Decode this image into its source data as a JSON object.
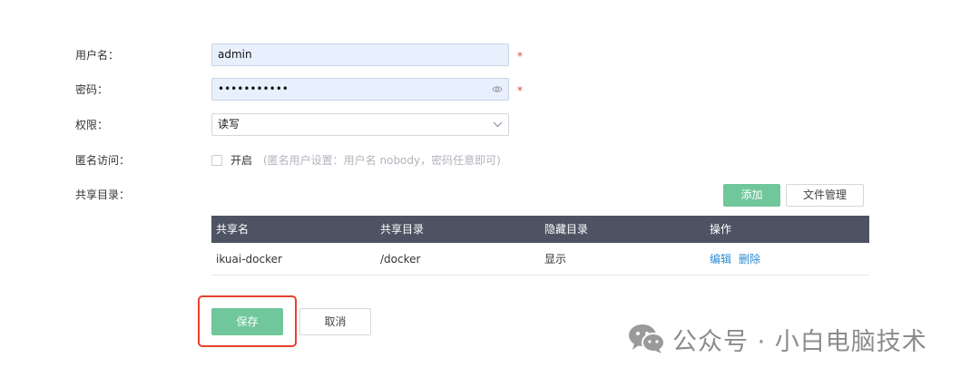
{
  "form": {
    "username": {
      "label": "用户名：",
      "value": "admin",
      "required_mark": "*"
    },
    "password": {
      "label": "密码：",
      "value": "•••••••••••",
      "required_mark": "*",
      "toggle_icon": "eye-icon"
    },
    "permission": {
      "label": "权限：",
      "value": "读写",
      "dropdown_icon": "chevron-down-icon"
    },
    "anonymous": {
      "label": "匿名访问：",
      "checkbox_label": "开启",
      "hint": "(匿名用户设置：用户名 nobody，密码任意即可)",
      "checked": false
    },
    "shared_dir": {
      "label": "共享目录："
    }
  },
  "actions": {
    "add_label": "添加",
    "file_manage_label": "文件管理",
    "save_label": "保存",
    "cancel_label": "取消"
  },
  "table": {
    "columns": [
      "共享名",
      "共享目录",
      "隐藏目录",
      "操作"
    ],
    "rows": [
      {
        "share_name": "ikuai-docker",
        "directory": "/docker",
        "hidden": "显示",
        "edit": "编辑",
        "delete": "删除"
      }
    ]
  },
  "watermark": {
    "text": "公众号 · 小白电脑技术",
    "icon": "wechat-icon"
  },
  "colors": {
    "accent_green": "#6fc79b",
    "table_header": "#4d5362",
    "link": "#2d8bd0",
    "required": "#e2493b",
    "highlight": "#e5412f"
  }
}
